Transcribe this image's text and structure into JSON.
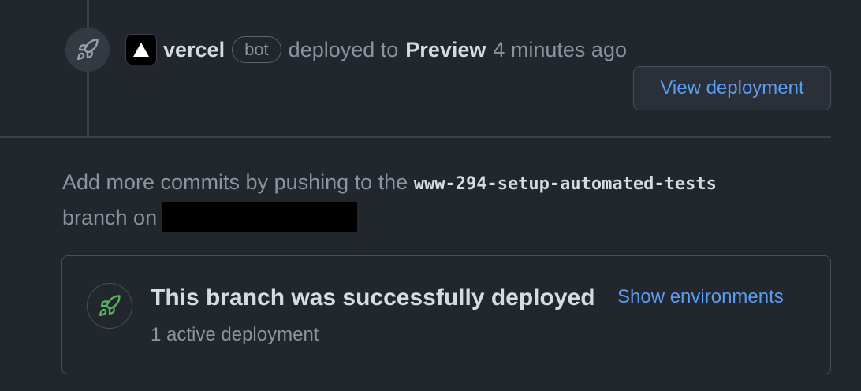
{
  "event": {
    "icon": "rocket-icon",
    "actor_avatar_icon": "vercel-triangle-icon",
    "actor": "vercel",
    "badge": "bot",
    "action_text": "deployed to",
    "environment": "Preview",
    "time": "4 minutes ago",
    "view_button_label": "View deployment"
  },
  "push_hint": {
    "prefix": "Add more commits by pushing to the",
    "branch": "www-294-setup-automated-tests",
    "suffix": "branch on"
  },
  "deployment_status": {
    "icon": "rocket-icon",
    "title": "This branch was successfully deployed",
    "link_label": "Show environments",
    "subtitle": "1 active deployment"
  },
  "colors": {
    "background": "#22262d",
    "link": "#5b9cf0",
    "success": "#56b35c"
  }
}
